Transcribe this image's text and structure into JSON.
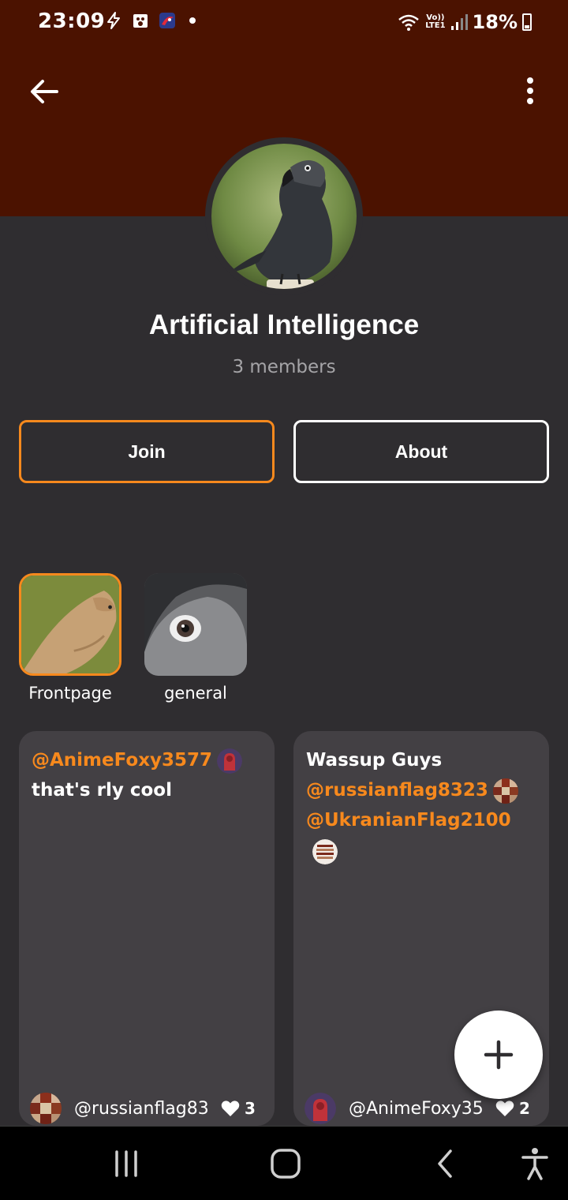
{
  "status_bar": {
    "time": "23:09",
    "battery_pct": "18%",
    "volte_top": "Vo))",
    "volte_bottom": "LTE1"
  },
  "header": {
    "back_icon": "arrow-left-icon",
    "more_icon": "more-vertical-icon",
    "bg_color": "#4b1200"
  },
  "community": {
    "name": "Artificial Intelligence",
    "members": "3 members",
    "avatar_icon": "parrot-image"
  },
  "actions": {
    "join_label": "Join",
    "about_label": "About",
    "accent_color": "#f7891d"
  },
  "channels": [
    {
      "label": "Frontpage",
      "selected": true
    },
    {
      "label": "general",
      "selected": false
    }
  ],
  "posts": [
    {
      "mention": "@AnimeFoxy3577",
      "text": "that's rly cool",
      "author": "@russianflag83",
      "likes": "3"
    },
    {
      "title": "Wassup Guys",
      "mention1": "@russianflag8323",
      "mention2": "@UkranianFlag2100",
      "author": "@AnimeFoxy35",
      "likes": "2"
    }
  ],
  "fab": {
    "icon": "plus-icon"
  },
  "nav_bar": {
    "recents_icon": "recents-icon",
    "home_icon": "home-icon",
    "back_icon": "back-chevron-icon",
    "accessibility_icon": "accessibility-icon"
  }
}
